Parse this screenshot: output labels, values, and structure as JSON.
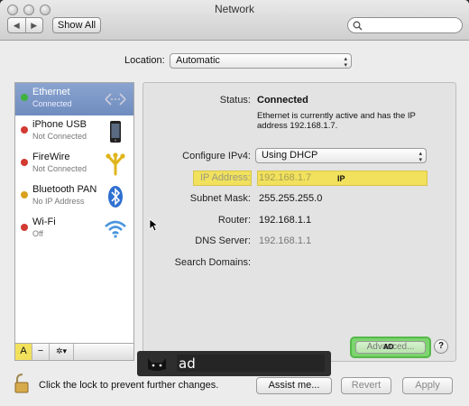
{
  "window": {
    "title": "Network"
  },
  "toolbar": {
    "back": "◀",
    "forward": "▶",
    "show_all": "Show All",
    "search_placeholder": ""
  },
  "location": {
    "label": "Location:",
    "value": "Automatic"
  },
  "services": [
    {
      "name": "Ethernet",
      "status": "Connected",
      "dot_color": "#3fb33f",
      "icon": "ethernet-icon",
      "selected": true
    },
    {
      "name": "iPhone USB",
      "status": "Not Connected",
      "dot_color": "#d23a32",
      "icon": "iphone-icon"
    },
    {
      "name": "FireWire",
      "status": "Not Connected",
      "dot_color": "#d23a32",
      "icon": "firewire-icon"
    },
    {
      "name": "Bluetooth PAN",
      "status": "No IP Address",
      "dot_color": "#d9a21d",
      "icon": "bluetooth-icon"
    },
    {
      "name": "Wi-Fi",
      "status": "Off",
      "dot_color": "#d23a32",
      "icon": "wifi-icon"
    }
  ],
  "sidebar_buttons": {
    "add": "A",
    "remove": "−",
    "action": "✲▾"
  },
  "detail": {
    "status_label": "Status:",
    "status_value": "Connected",
    "status_desc_1": "Ethernet is currently active and has the IP",
    "status_desc_2": "address 192.168.1.7.",
    "configure_label": "Configure IPv4:",
    "configure_value": "Using DHCP",
    "ip_label": "IP Address:",
    "ip_value": "192.168.1.7",
    "ip_marker": "IP",
    "subnet_label": "Subnet Mask:",
    "subnet_value": "255.255.255.0",
    "router_label": "Router:",
    "router_value": "192.168.1.1",
    "dns_label": "DNS Server:",
    "dns_value": "192.168.1.1",
    "search_domains_label": "Search Domains:"
  },
  "advanced": {
    "label": "Advanced...",
    "marker": "AD"
  },
  "help": "?",
  "tooltip": {
    "text": "ad"
  },
  "footer": {
    "lock_text": "Click the lock to prevent further changes.",
    "assist": "Assist me...",
    "revert": "Revert",
    "apply": "Apply"
  },
  "colors": {
    "selection": "#7890c4",
    "highlight": "#f1e15c",
    "advanced_highlight": "#7cd46e"
  }
}
